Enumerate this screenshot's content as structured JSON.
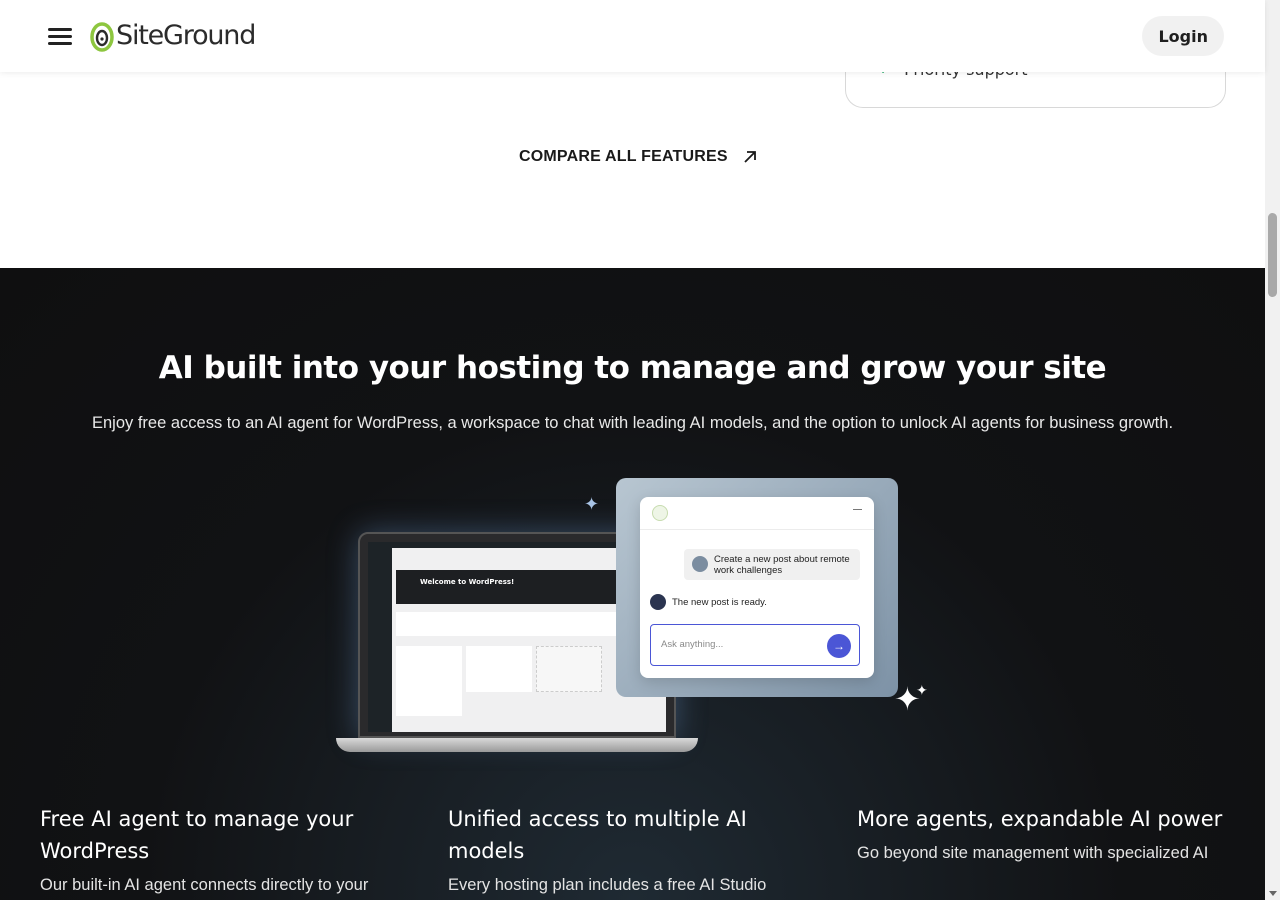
{
  "header": {
    "logo_text": "SiteGround",
    "login_label": "Login"
  },
  "plan_card": {
    "feature": "Priority support"
  },
  "compare_link": "COMPARE ALL FEATURES",
  "ai_section": {
    "title": "AI built into your hosting to manage and grow your site",
    "lead": "Enjoy free access to an AI agent for WordPress, a workspace to chat with leading AI models, and the option to unlock AI agents for business growth.",
    "illustration": {
      "wp_welcome": "Welcome to WordPress!",
      "chat_user_message": "Create a new post about remote work challenges",
      "chat_bot_message": "The new post is ready.",
      "chat_placeholder": "Ask anything..."
    },
    "features": [
      {
        "title": "Free AI agent to manage your WordPress",
        "text": "Our built-in AI agent connects directly to your"
      },
      {
        "title": "Unified access to multiple AI models",
        "text": "Every hosting plan includes a free AI Studio"
      },
      {
        "title": "More agents, expandable AI power",
        "text": "Go beyond site management with specialized AI"
      }
    ]
  },
  "colors": {
    "accent_green": "#8dc63f",
    "brand_check": "#1fa864",
    "chat_accent": "#4b56d6",
    "dark_bg": "#111214"
  }
}
